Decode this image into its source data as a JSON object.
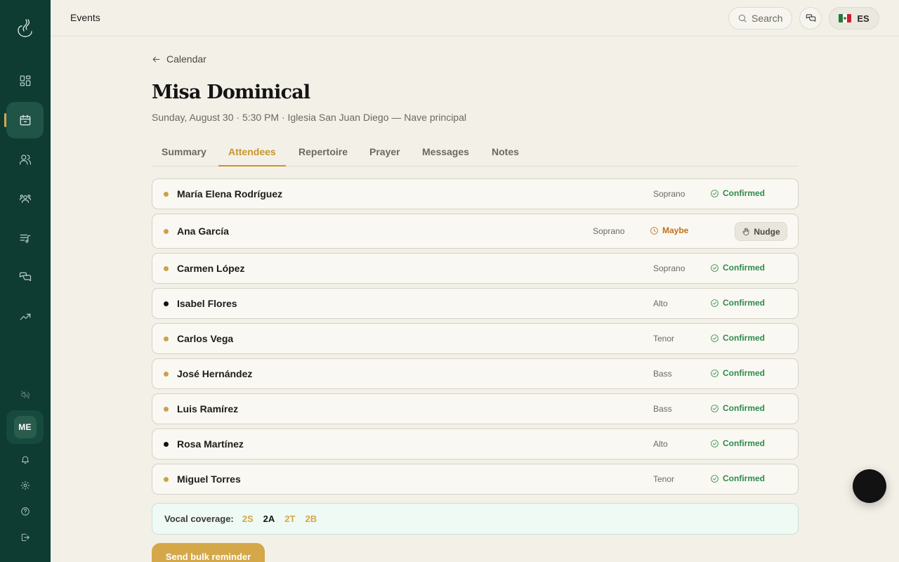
{
  "sidebar": {
    "avatar_initials": "ME",
    "nav_icons": [
      "dashboard-icon",
      "calendar-icon",
      "members-icon",
      "groups-icon",
      "music-list-icon",
      "messages-icon",
      "analytics-icon"
    ],
    "active_item": "calendar-icon",
    "bottom_icons": [
      "mute-icon",
      "bell-icon",
      "gear-icon",
      "help-icon",
      "logout-icon"
    ]
  },
  "topbar": {
    "title": "Events",
    "search_label": "Search",
    "language": "ES"
  },
  "page": {
    "back_label": "Calendar",
    "title": "Misa Dominical",
    "subtitle": "Sunday, August 30 · 5:30 PM · Iglesia San Juan Diego — Nave principal"
  },
  "tabs": [
    {
      "label": "Summary",
      "active": false
    },
    {
      "label": "Attendees",
      "active": true
    },
    {
      "label": "Repertoire",
      "active": false
    },
    {
      "label": "Prayer",
      "active": false
    },
    {
      "label": "Messages",
      "active": false
    },
    {
      "label": "Notes",
      "active": false
    }
  ],
  "attendees": [
    {
      "name": "María Elena Rodríguez",
      "part": "Soprano",
      "status": "Confirmed",
      "dot_color": "#c9a24a"
    },
    {
      "name": "Ana García",
      "part": "Soprano",
      "status": "Maybe",
      "dot_color": "#c9a24a",
      "action": "Nudge"
    },
    {
      "name": "Carmen López",
      "part": "Soprano",
      "status": "Confirmed",
      "dot_color": "#c9a24a"
    },
    {
      "name": "Isabel Flores",
      "part": "Alto",
      "status": "Confirmed",
      "dot_color": "#141414"
    },
    {
      "name": "Carlos Vega",
      "part": "Tenor",
      "status": "Confirmed",
      "dot_color": "#c9a24a"
    },
    {
      "name": "José Hernández",
      "part": "Bass",
      "status": "Confirmed",
      "dot_color": "#c9a24a"
    },
    {
      "name": "Luis Ramírez",
      "part": "Bass",
      "status": "Confirmed",
      "dot_color": "#c9a24a"
    },
    {
      "name": "Rosa Martínez",
      "part": "Alto",
      "status": "Confirmed",
      "dot_color": "#141414"
    },
    {
      "name": "Miguel Torres",
      "part": "Tenor",
      "status": "Confirmed",
      "dot_color": "#c9a24a"
    }
  ],
  "coverage": {
    "label": "Vocal coverage:",
    "parts": [
      {
        "label": "2S",
        "color": "#d4a849"
      },
      {
        "label": "2A",
        "color": "#141414"
      },
      {
        "label": "2T",
        "color": "#d4a849"
      },
      {
        "label": "2B",
        "color": "#d4a849"
      }
    ]
  },
  "actions": {
    "bulk_reminder": "Send bulk reminder"
  },
  "colors": {
    "sidebar_bg": "#0e3b32",
    "accent": "#c9962e",
    "confirmed": "#2e8b4e",
    "maybe": "#c0731c"
  }
}
